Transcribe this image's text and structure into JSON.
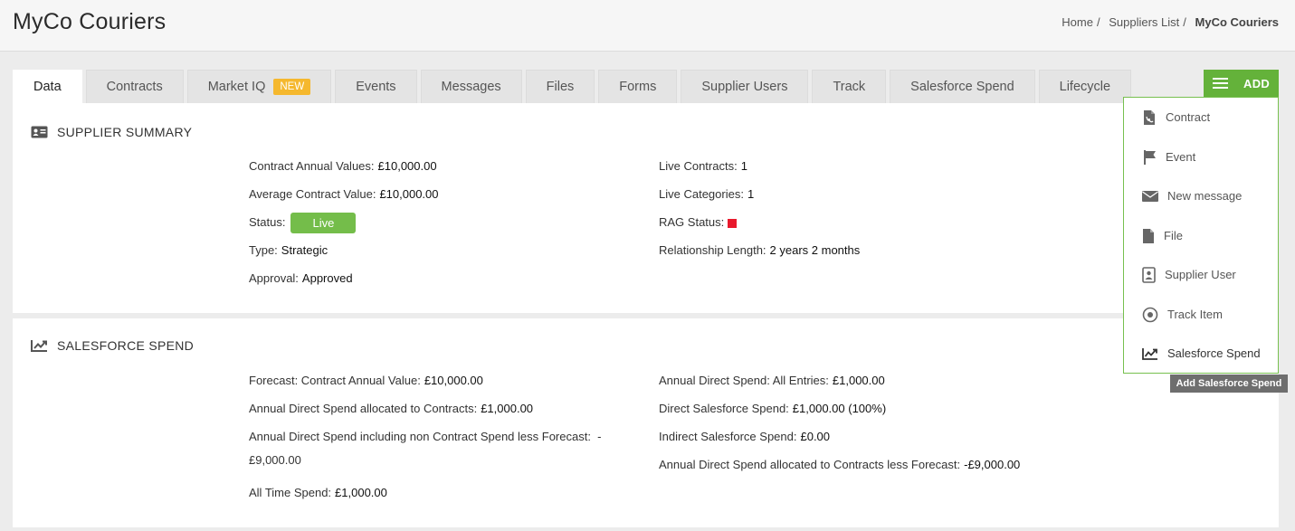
{
  "header": {
    "title": "MyCo Couriers",
    "breadcrumb": [
      "Home",
      "Suppliers List",
      "MyCo Couriers"
    ],
    "breadcrumb_sep": "/"
  },
  "tabs": [
    {
      "label": "Data",
      "active": true
    },
    {
      "label": "Contracts"
    },
    {
      "label": "Market IQ",
      "badge": "NEW"
    },
    {
      "label": "Events"
    },
    {
      "label": "Messages"
    },
    {
      "label": "Files"
    },
    {
      "label": "Forms"
    },
    {
      "label": "Supplier Users"
    },
    {
      "label": "Track"
    },
    {
      "label": "Salesforce Spend"
    },
    {
      "label": "Lifecycle"
    }
  ],
  "add_button": {
    "label": "ADD",
    "icon": "hamburger-icon"
  },
  "add_menu": {
    "items": [
      {
        "label": "Contract",
        "icon": "contract-icon"
      },
      {
        "label": "Event",
        "icon": "flag-icon"
      },
      {
        "label": "New message",
        "icon": "envelope-icon"
      },
      {
        "label": "File",
        "icon": "file-icon"
      },
      {
        "label": "Supplier User",
        "icon": "user-card-icon"
      },
      {
        "label": "Track Item",
        "icon": "target-icon"
      },
      {
        "label": "Salesforce Spend",
        "icon": "chart-line-icon"
      }
    ],
    "tooltip": "Add Salesforce Spend"
  },
  "supplier_summary": {
    "heading": "SUPPLIER SUMMARY",
    "left": {
      "contract_annual_values": {
        "label": "Contract Annual Values:",
        "value": "£10,000.00"
      },
      "average_contract_value": {
        "label": "Average Contract Value:",
        "value": "£10,000.00"
      },
      "status": {
        "label": "Status:",
        "value": "Live"
      },
      "type": {
        "label": "Type:",
        "value": "Strategic"
      },
      "approval": {
        "label": "Approval:",
        "value": "Approved"
      }
    },
    "right": {
      "live_contracts": {
        "label": "Live Contracts:",
        "value": "1"
      },
      "live_categories": {
        "label": "Live Categories:",
        "value": "1"
      },
      "rag_status": {
        "label": "RAG Status:",
        "color": "#e8192c"
      },
      "relationship_length": {
        "label": "Relationship Length:",
        "value": "2 years 2 months"
      }
    }
  },
  "salesforce_spend": {
    "heading": "SALESFORCE SPEND",
    "left": {
      "forecast": {
        "label": "Forecast: Contract Annual Value:",
        "value": "£10,000.00"
      },
      "allocated": {
        "label": "Annual Direct Spend allocated to Contracts:",
        "value": "£1,000.00"
      },
      "non_contract_line1": "Annual Direct Spend including non Contract Spend less Forecast:  -",
      "non_contract_line2": "£9,000.00",
      "all_time": {
        "label": "All Time Spend:",
        "value": "£1,000.00"
      }
    },
    "right": {
      "all_entries": {
        "label": "Annual Direct Spend: All Entries:",
        "value": "£1,000.00"
      },
      "direct": {
        "label": "Direct Salesforce Spend:",
        "value": "£1,000.00 (100%)"
      },
      "indirect": {
        "label": "Indirect Salesforce Spend:",
        "value": "£0.00"
      },
      "less_forecast": {
        "label": "Annual Direct Spend allocated to Contracts less Forecast:",
        "value": "-£9,000.00"
      }
    }
  },
  "colors": {
    "accent": "#64b23a",
    "badge": "#f5b82e",
    "status_live": "#74bd4a",
    "rag": "#e8192c"
  }
}
